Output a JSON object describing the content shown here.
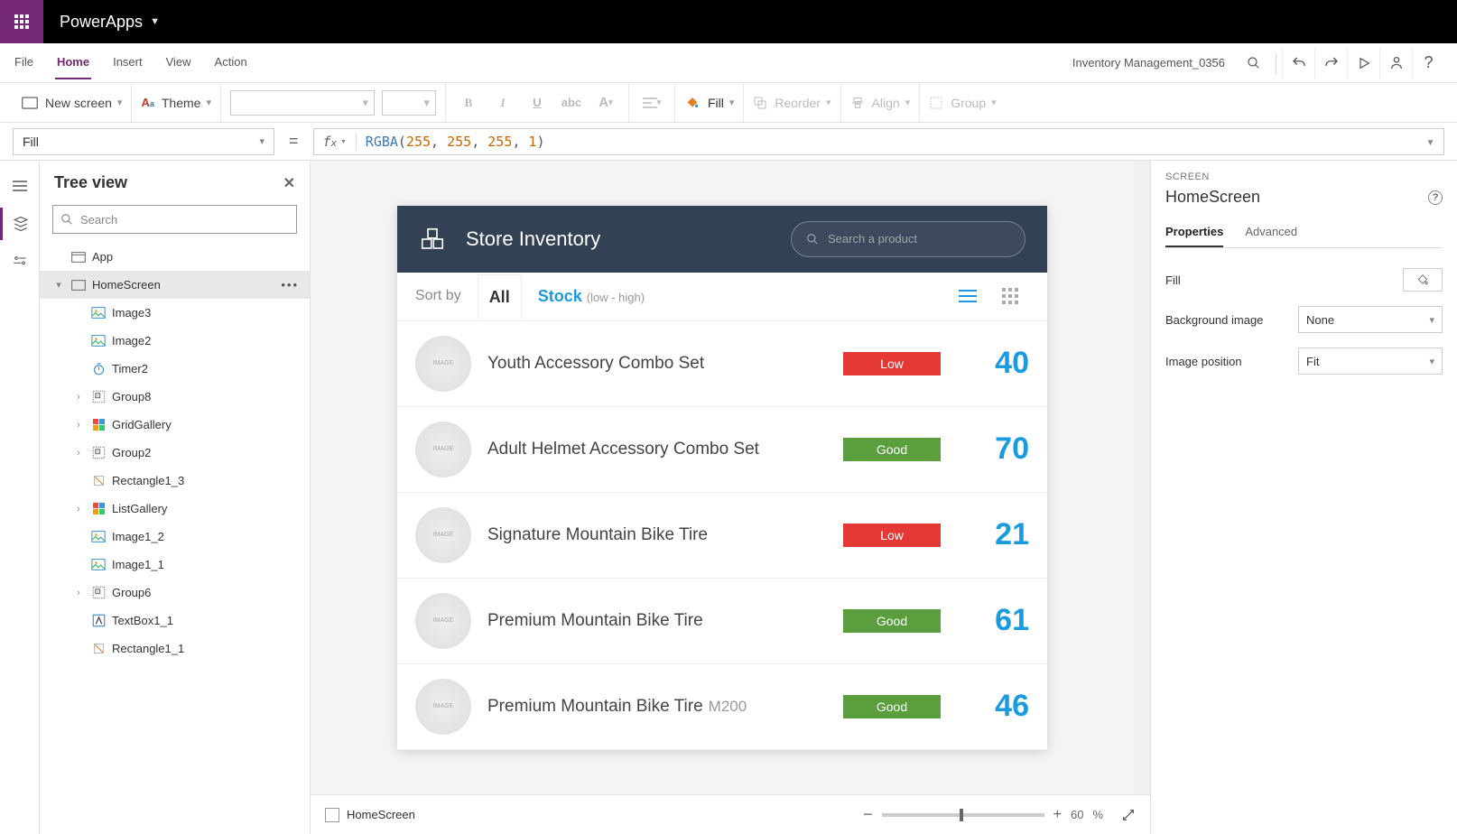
{
  "header": {
    "appName": "PowerApps"
  },
  "menubar": {
    "items": [
      "File",
      "Home",
      "Insert",
      "View",
      "Action"
    ],
    "activeIndex": 1,
    "projectName": "Inventory Management_0356"
  },
  "toolbar": {
    "newScreen": "New screen",
    "theme": "Theme",
    "fill": "Fill",
    "reorder": "Reorder",
    "align": "Align",
    "group": "Group"
  },
  "formula": {
    "property": "Fill",
    "fn": "RGBA",
    "args": [
      "255",
      "255",
      "255",
      "1"
    ]
  },
  "tree": {
    "title": "Tree view",
    "searchPlaceholder": "Search",
    "items": [
      {
        "label": "App",
        "icon": "app",
        "depth": 0
      },
      {
        "label": "HomeScreen",
        "icon": "screen",
        "depth": 0,
        "expanded": true,
        "selected": true,
        "more": true
      },
      {
        "label": "Image3",
        "icon": "image",
        "depth": 1
      },
      {
        "label": "Image2",
        "icon": "image",
        "depth": 1
      },
      {
        "label": "Timer2",
        "icon": "timer",
        "depth": 1
      },
      {
        "label": "Group8",
        "icon": "group",
        "depth": 1,
        "chev": true
      },
      {
        "label": "GridGallery",
        "icon": "grid",
        "depth": 1,
        "chev": true
      },
      {
        "label": "Group2",
        "icon": "group",
        "depth": 1,
        "chev": true
      },
      {
        "label": "Rectangle1_3",
        "icon": "rect",
        "depth": 1
      },
      {
        "label": "ListGallery",
        "icon": "grid",
        "depth": 1,
        "chev": true
      },
      {
        "label": "Image1_2",
        "icon": "image",
        "depth": 1
      },
      {
        "label": "Image1_1",
        "icon": "image",
        "depth": 1
      },
      {
        "label": "Group6",
        "icon": "group",
        "depth": 1,
        "chev": true
      },
      {
        "label": "TextBox1_1",
        "icon": "text",
        "depth": 1
      },
      {
        "label": "Rectangle1_1",
        "icon": "rect",
        "depth": 1
      }
    ]
  },
  "appPreview": {
    "title": "Store Inventory",
    "searchPlaceholder": "Search a product",
    "sortBy": "Sort by",
    "tabAll": "All",
    "tabStock": "Stock",
    "stockHint": "(low - high)",
    "rows": [
      {
        "name": "Youth Accessory Combo Set",
        "variant": "",
        "badge": "Low",
        "badgeClass": "low",
        "qty": "40"
      },
      {
        "name": "Adult Helmet Accessory Combo Set",
        "variant": "",
        "badge": "Good",
        "badgeClass": "good",
        "qty": "70"
      },
      {
        "name": "Signature Mountain Bike Tire",
        "variant": "",
        "badge": "Low",
        "badgeClass": "low",
        "qty": "21"
      },
      {
        "name": "Premium Mountain Bike Tire",
        "variant": "",
        "badge": "Good",
        "badgeClass": "good",
        "qty": "61"
      },
      {
        "name": "Premium Mountain Bike Tire",
        "variant": "M200",
        "badge": "Good",
        "badgeClass": "good",
        "qty": "46"
      }
    ]
  },
  "canvasFooter": {
    "screenLabel": "HomeScreen",
    "zoomPct": "60",
    "zoomUnit": "%"
  },
  "propPanel": {
    "category": "SCREEN",
    "name": "HomeScreen",
    "tabs": [
      "Properties",
      "Advanced"
    ],
    "rows": {
      "fill": "Fill",
      "bgImage": "Background image",
      "bgImageValue": "None",
      "imgPos": "Image position",
      "imgPosValue": "Fit"
    }
  }
}
